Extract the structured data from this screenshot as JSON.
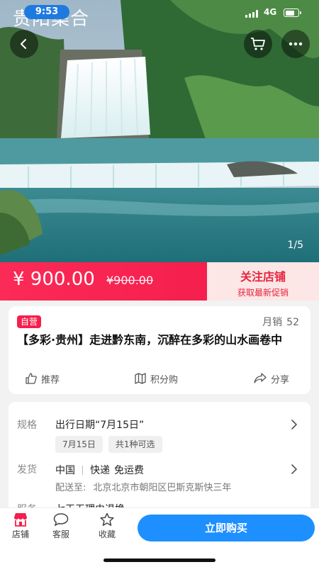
{
  "status": {
    "time": "9:53",
    "network": "4G"
  },
  "hero": {
    "title": "贵阳集合",
    "counter": "1/5"
  },
  "price": {
    "current": "¥ 900.00",
    "original": "¥900.00"
  },
  "follow": {
    "title": "关注店铺",
    "subtitle": "获取最新促销"
  },
  "product": {
    "badge": "自营",
    "sales_label": "月销",
    "sales_count": "52",
    "title": "【多彩·贵州】走进黔东南，沉醉在多彩的山水画卷中",
    "actions": {
      "recommend": "推荐",
      "points": "积分购",
      "share": "分享"
    }
  },
  "spec": {
    "label": "规格",
    "value": "出行日期“7月15日”",
    "options": [
      "7月15日",
      "共1种可选"
    ]
  },
  "shipping": {
    "label": "发货",
    "origin": "中国",
    "method": "快递",
    "fee": "免运费",
    "deliver_label": "配送至:",
    "deliver_address": "北京北京市朝阳区巴斯克斯快三年"
  },
  "service": {
    "label": "服务",
    "value": "七天无理由退换"
  },
  "bottom": {
    "store": "店铺",
    "service": "客服",
    "favorite": "收藏",
    "buy": "立即购买"
  },
  "colors": {
    "price_red": "#f51f4d",
    "buy_blue": "#1d8fff",
    "follow_bg": "#fde6e6"
  }
}
